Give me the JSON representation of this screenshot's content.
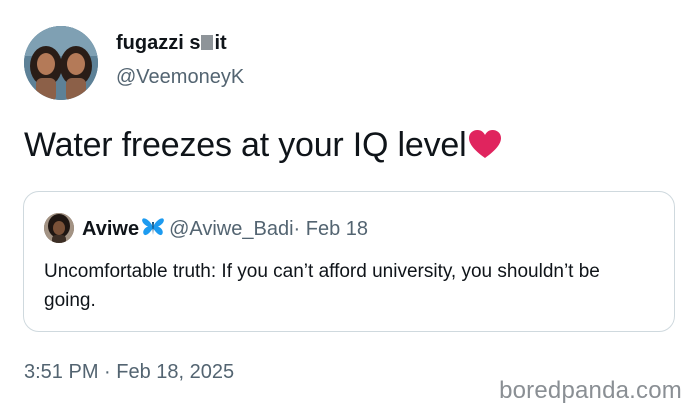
{
  "author": {
    "display_name_prefix": "fugazzi s",
    "display_name_suffix": "it",
    "handle": "@VeemoneyK"
  },
  "tweet": {
    "text": "Water freezes at your IQ level",
    "emoji": "red-heart",
    "timestamp": "3:51 PM · Feb 18, 2025"
  },
  "quoted_tweet": {
    "author_name": "Aviwe",
    "author_emoji": "blue-butterfly",
    "author_handle": "@Aviwe_Badi",
    "separator": "·",
    "date": "Feb 18",
    "text": "Uncomfortable truth: If you can’t afford university, you shouldn’t be going."
  },
  "watermark": "boredpanda.com",
  "colors": {
    "primary_text": "#0f1419",
    "secondary_text": "#536471",
    "border": "#cfd9de",
    "heart": "#e0245e",
    "butterfly": "#1d9bf0"
  }
}
